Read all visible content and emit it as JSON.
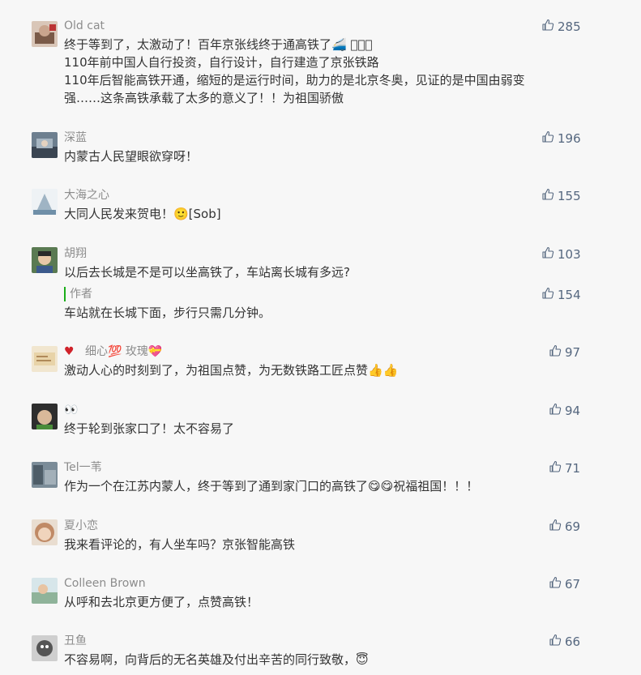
{
  "comments": [
    {
      "nickname": "Old cat",
      "lines": [
        "终于等到了，太激动了！百年京张线终于通高铁了🚄 🏻🏻🏻",
        "110年前中国人自行投资，自行设计，自行建造了京张铁路",
        "110年后智能高铁开通，缩短的是运行时间，助力的是北京冬奥，见证的是中国由弱变",
        "强……这条高铁承载了太多的意义了！！为祖国骄傲"
      ],
      "likes": "285"
    },
    {
      "nickname": "深蓝",
      "lines": [
        "内蒙古人民望眼欲穿呀！"
      ],
      "likes": "196"
    },
    {
      "nickname": "大海之心",
      "lines": [
        "大同人民发来贺电！🙂[Sob]"
      ],
      "likes": "155"
    },
    {
      "nickname": "胡翔",
      "lines": [
        "以后去长城是不是可以坐高铁了，车站离长城有多远?"
      ],
      "likes": "103",
      "reply": {
        "label": "作者",
        "text": "车站就在长城下面，步行只需几分钟。",
        "likes": "154"
      }
    },
    {
      "nickname": "细心💯 玫瑰💝",
      "lines": [
        "激动人心的时刻到了，为祖国点赞，为无数铁路工匠点赞👍👍"
      ],
      "likes": "97"
    },
    {
      "nickname": "👀",
      "lines": [
        "终于轮到张家口了！太不容易了"
      ],
      "likes": "94"
    },
    {
      "nickname": "Tel一苇",
      "lines": [
        "作为一个在江苏内蒙人，终于等到了通到家门口的高铁了😋😋祝福祖国！！！"
      ],
      "likes": "71"
    },
    {
      "nickname": "夏小恋",
      "lines": [
        "我来看评论的，有人坐车吗？京张智能高铁"
      ],
      "likes": "69"
    },
    {
      "nickname": "Colleen Brown",
      "lines": [
        "从呼和去北京更方便了，点赞高铁！"
      ],
      "likes": "67"
    },
    {
      "nickname": "丑鱼",
      "lines": [
        "不容易啊，向背后的无名英雄及付出辛苦的同行致敬，😇"
      ],
      "likes": "66"
    }
  ],
  "colors": {
    "nickname": "#8c8c8c",
    "text": "#333333",
    "like": "#55677f",
    "author_bar": "#1aad19"
  },
  "icons": {
    "like": "thumbs-up-icon"
  }
}
